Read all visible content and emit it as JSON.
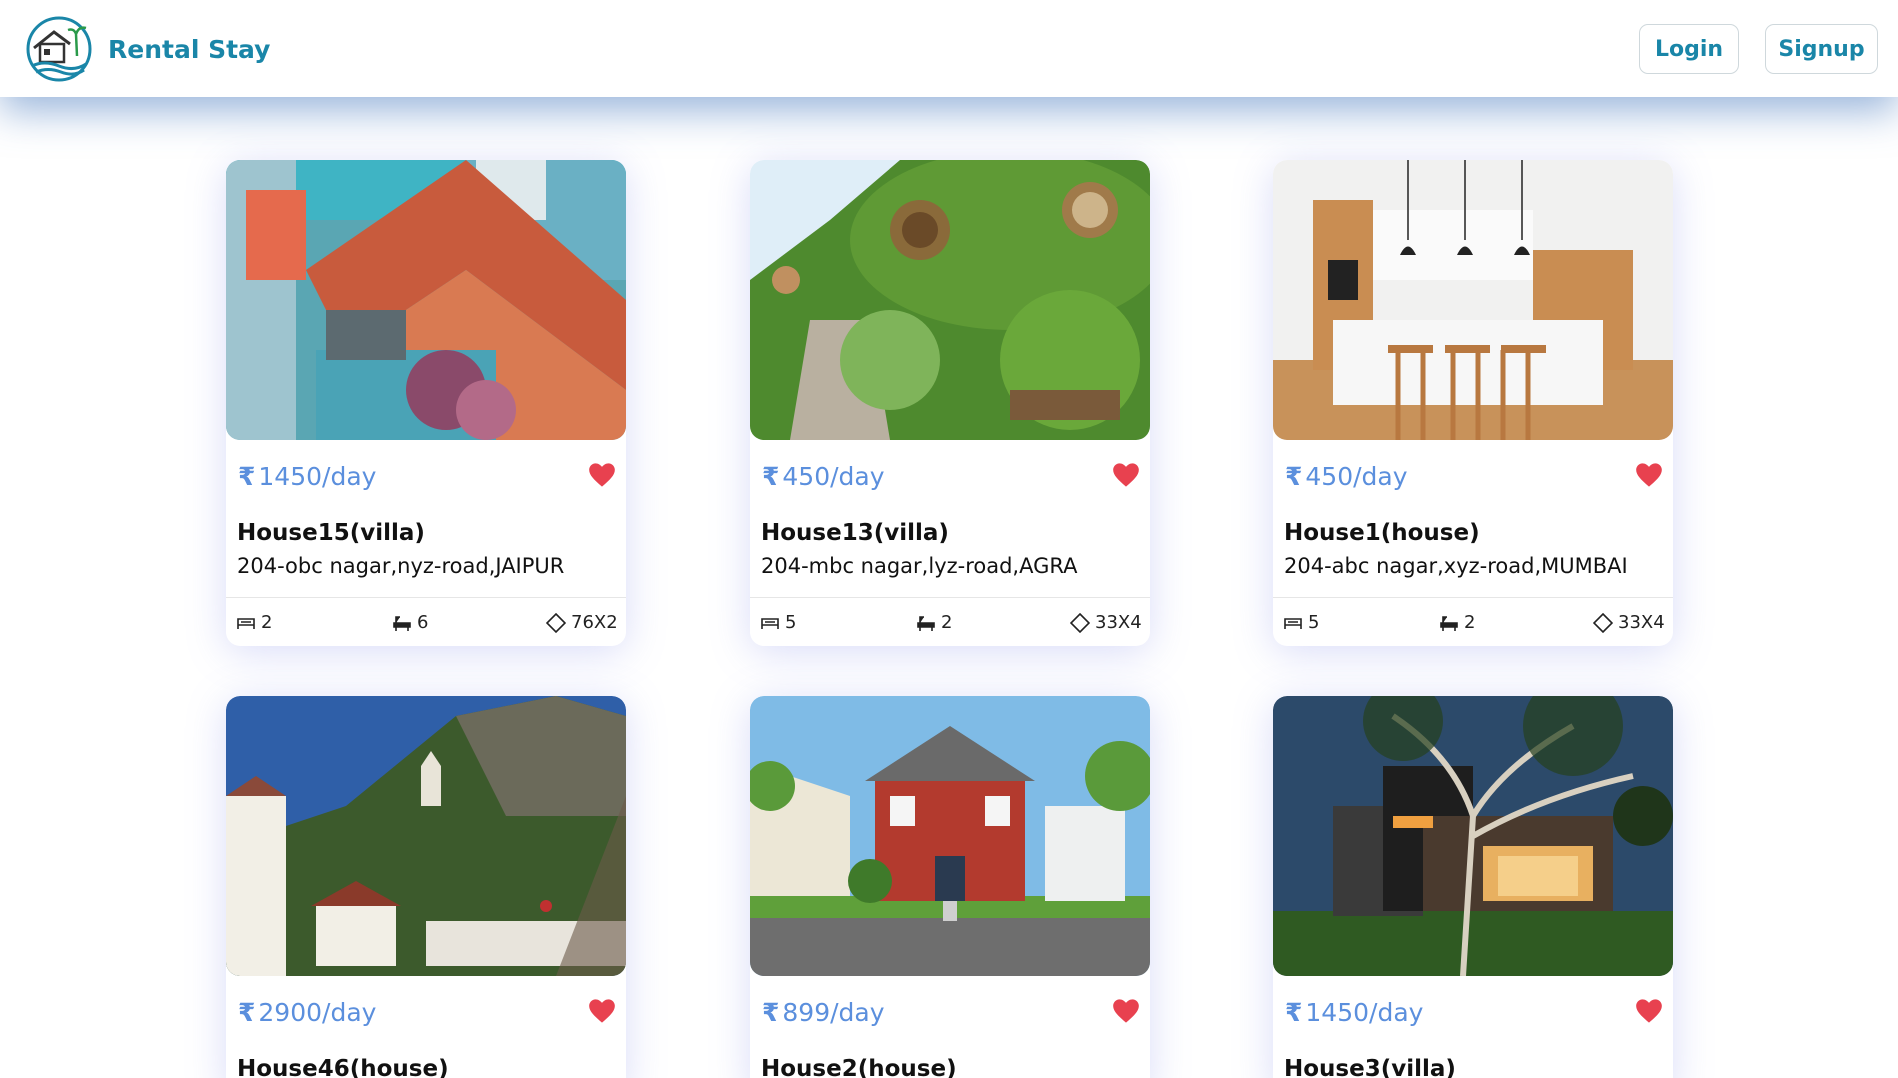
{
  "app": {
    "name": "Rental Stay"
  },
  "nav": {
    "login_label": "Login",
    "signup_label": "Signup"
  },
  "currency_symbol": "₹",
  "colors": {
    "brand": "#1a86a8",
    "price": "#5b8fdd",
    "heart": "#e8414f"
  },
  "listings": [
    {
      "price": "1450/day",
      "title": "House15(villa)",
      "address": "204-obc nagar,nyz-road,JAIPUR",
      "beds": "2",
      "baths": "6",
      "area": "76X2",
      "image": "coastal-house-red-roof",
      "favorite": true
    },
    {
      "price": "450/day",
      "title": "House13(villa)",
      "address": "204-mbc nagar,lyz-road,AGRA",
      "beds": "5",
      "baths": "2",
      "area": "33X4",
      "image": "hobbit-hill-house",
      "favorite": true
    },
    {
      "price": "450/day",
      "title": "House1(house)",
      "address": "204-abc nagar,xyz-road,MUMBAI",
      "beds": "5",
      "baths": "2",
      "area": "33X4",
      "image": "modern-kitchen",
      "favorite": true
    },
    {
      "price": "2900/day",
      "title": "House46(house)",
      "image": "alpine-village-castle",
      "favorite": true
    },
    {
      "price": "899/day",
      "title": "House2(house)",
      "image": "red-suburban-house",
      "favorite": true
    },
    {
      "price": "1450/day",
      "title": "House3(villa)",
      "image": "modern-house-night",
      "favorite": true
    }
  ]
}
